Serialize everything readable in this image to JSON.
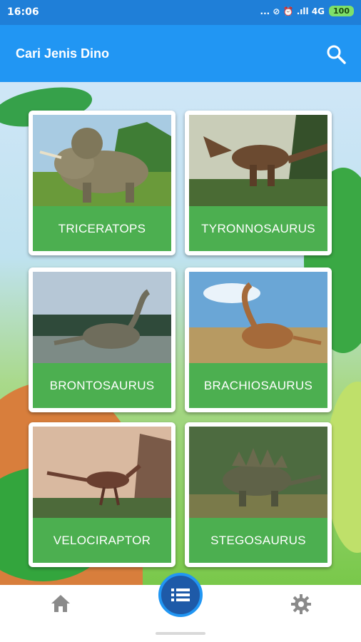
{
  "status_bar": {
    "time": "16:06",
    "icons_text": "... ⊘ ⏰ .ıll 4G",
    "battery": "100"
  },
  "app_bar": {
    "title": "Cari Jenis Dino",
    "search_icon": "search-icon"
  },
  "dinos": [
    {
      "label": "TRICERATOPS"
    },
    {
      "label": "TYRONNOSAURUS"
    },
    {
      "label": "BRONTOSAURUS"
    },
    {
      "label": "BRACHIOSAURUS"
    },
    {
      "label": "VELOCIRAPTOR"
    },
    {
      "label": "STEGOSAURUS"
    }
  ],
  "bottom_nav": {
    "home_icon": "home-icon",
    "list_icon": "list-icon",
    "settings_icon": "gear-icon"
  },
  "colors": {
    "appbar": "#2196f3",
    "statusbar": "#1f7fd8",
    "card_label": "#4caf50",
    "fab": "#1e5aa8"
  }
}
